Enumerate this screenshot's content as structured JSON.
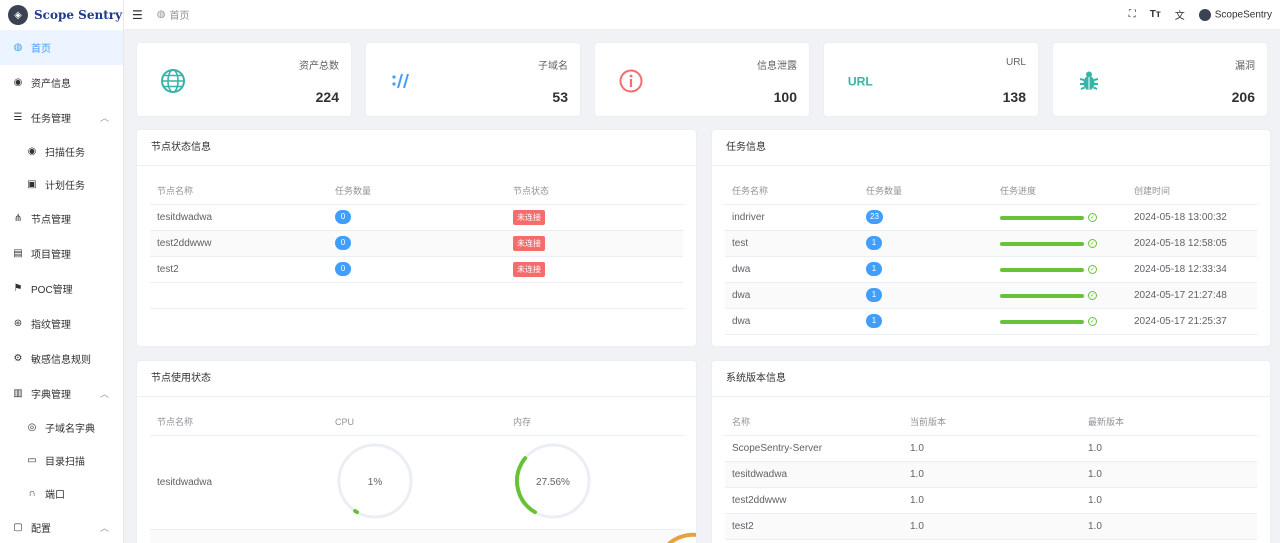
{
  "app": {
    "title": "Scope Sentry"
  },
  "sidebar": {
    "items": [
      {
        "label": "首页",
        "icon": "home-icon",
        "active": true
      },
      {
        "label": "资产信息",
        "icon": "eye-icon"
      },
      {
        "label": "任务管理",
        "icon": "list-icon",
        "expandable": true
      },
      {
        "label": "扫描任务",
        "icon": "eye-icon",
        "sub": true
      },
      {
        "label": "计划任务",
        "icon": "calendar-icon",
        "sub": true
      },
      {
        "label": "节点管理",
        "icon": "nodes-icon"
      },
      {
        "label": "项目管理",
        "icon": "clipboard-icon"
      },
      {
        "label": "POC管理",
        "icon": "poc-icon"
      },
      {
        "label": "指纹管理",
        "icon": "fingerprint-icon"
      },
      {
        "label": "敏感信息规则",
        "icon": "rule-icon"
      },
      {
        "label": "字典管理",
        "icon": "book-icon",
        "expandable": true
      },
      {
        "label": "子域名字典",
        "icon": "globe-icon",
        "sub": true
      },
      {
        "label": "目录扫描",
        "icon": "folder-icon",
        "sub": true
      },
      {
        "label": "端口",
        "icon": "port-icon",
        "sub": true
      },
      {
        "label": "配置",
        "icon": "config-icon",
        "expandable": true
      }
    ]
  },
  "topbar": {
    "breadcrumb": "首页",
    "user": "ScopeSentry"
  },
  "stats": [
    {
      "label": "资产总数",
      "value": "224",
      "icon": "globe-icon",
      "color": "#36b4a7"
    },
    {
      "label": "子域名",
      "value": "53",
      "icon": "link-icon",
      "color": "#409eff"
    },
    {
      "label": "信息泄露",
      "value": "100",
      "icon": "info-icon",
      "color": "#f56c6c"
    },
    {
      "label": "URL",
      "value": "138",
      "icon": "url-icon",
      "color": "#36b4a7"
    },
    {
      "label": "漏洞",
      "value": "206",
      "icon": "bug-icon",
      "color": "#36b4a7"
    }
  ],
  "node_status": {
    "title": "节点状态信息",
    "columns": [
      "节点名称",
      "任务数量",
      "节点状态"
    ],
    "rows": [
      {
        "name": "tesitdwadwa",
        "tasks": "0",
        "status": "未连接"
      },
      {
        "name": "test2ddwww",
        "tasks": "0",
        "status": "未连接"
      },
      {
        "name": "test2",
        "tasks": "0",
        "status": "未连接"
      }
    ]
  },
  "task_info": {
    "title": "任务信息",
    "columns": [
      "任务名称",
      "任务数量",
      "任务进度",
      "创建时间"
    ],
    "rows": [
      {
        "name": "indriver",
        "count": "23",
        "progress": 1.0,
        "created": "2024-05-18 13:00:32"
      },
      {
        "name": "test",
        "count": "1",
        "progress": 1.0,
        "created": "2024-05-18 12:58:05"
      },
      {
        "name": "dwa",
        "count": "1",
        "progress": 1.0,
        "created": "2024-05-18 12:33:34"
      },
      {
        "name": "dwa",
        "count": "1",
        "progress": 1.0,
        "created": "2024-05-17 21:27:48"
      },
      {
        "name": "dwa",
        "count": "1",
        "progress": 1.0,
        "created": "2024-05-17 21:25:37"
      }
    ]
  },
  "node_usage": {
    "title": "节点使用状态",
    "columns": [
      "节点名称",
      "CPU",
      "内存"
    ],
    "rows": [
      {
        "name": "tesitdwadwa",
        "cpu": "1%",
        "cpu_value": 0.01,
        "mem": "27.56%",
        "mem_value": 0.2756
      }
    ]
  },
  "version_info": {
    "title": "系统版本信息",
    "columns": [
      "名称",
      "当前版本",
      "最新版本"
    ],
    "rows": [
      {
        "name": "ScopeSentry-Server",
        "current": "1.0",
        "latest": "1.0"
      },
      {
        "name": "tesitdwadwa",
        "current": "1.0",
        "latest": "1.0"
      },
      {
        "name": "test2ddwww",
        "current": "1.0",
        "latest": "1.0"
      },
      {
        "name": "test2",
        "current": "1.0",
        "latest": "1.0"
      }
    ]
  },
  "colors": {
    "accent": "#409eff",
    "success": "#67c23a",
    "danger": "#f56c6c",
    "warning": "#e6a23c"
  }
}
